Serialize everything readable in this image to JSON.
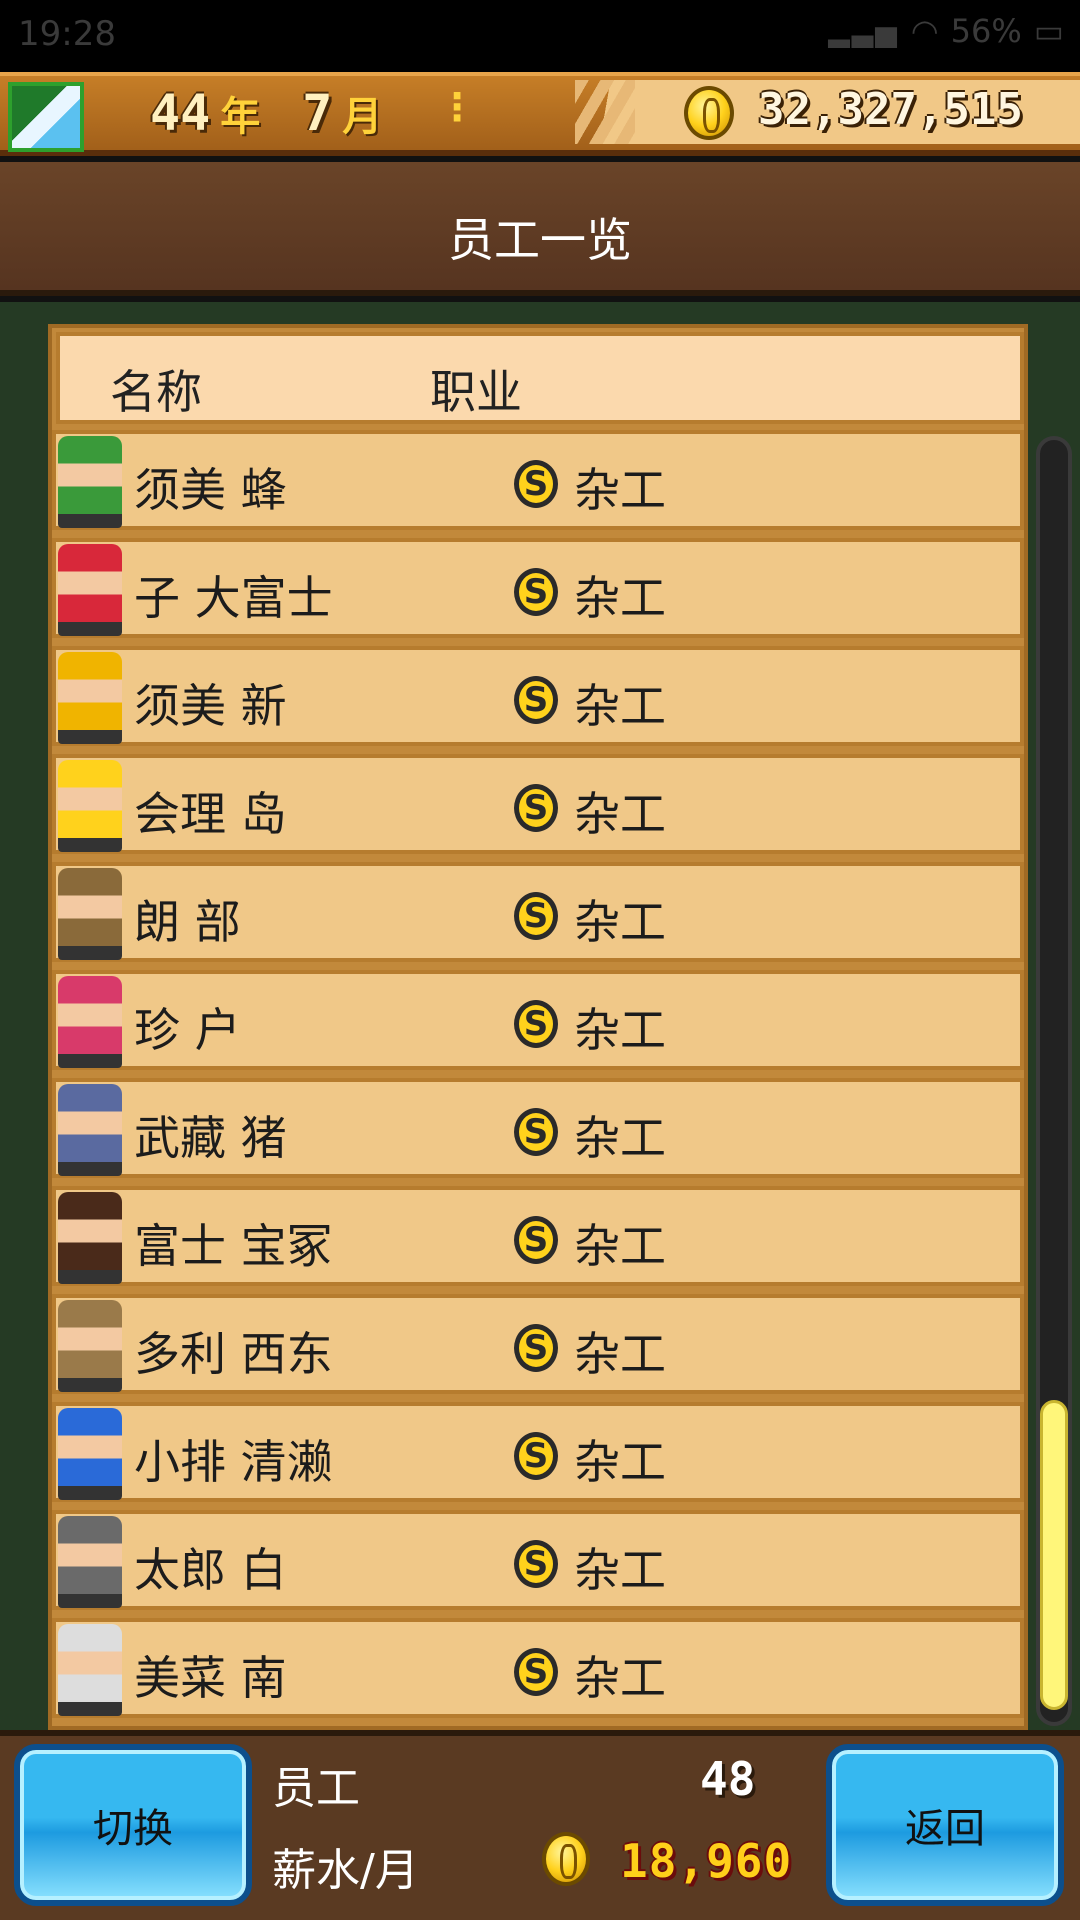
{
  "status_bar": {
    "time": "19:28",
    "indicators": "... HD",
    "battery": "56%"
  },
  "hud": {
    "year_value": "44",
    "year_unit": "年",
    "month_value": "7",
    "month_unit": "月",
    "money": "32,327,515",
    "menu_icon": "vertical-dots"
  },
  "screen": {
    "title": "员工一览"
  },
  "table": {
    "headers": {
      "name": "名称",
      "job": "职业"
    },
    "rows": [
      {
        "name": "须美 蜂",
        "job": "杂工",
        "rank": "S"
      },
      {
        "name": "子 大富士",
        "job": "杂工",
        "rank": "S"
      },
      {
        "name": "须美 新",
        "job": "杂工",
        "rank": "S"
      },
      {
        "name": "会理 岛",
        "job": "杂工",
        "rank": "S"
      },
      {
        "name": "朗 部",
        "job": "杂工",
        "rank": "S"
      },
      {
        "name": "珍 户",
        "job": "杂工",
        "rank": "S"
      },
      {
        "name": "武藏 猪",
        "job": "杂工",
        "rank": "S"
      },
      {
        "name": "富士 宝冢",
        "job": "杂工",
        "rank": "S"
      },
      {
        "name": "多利 西东",
        "job": "杂工",
        "rank": "S"
      },
      {
        "name": "小排 清濑",
        "job": "杂工",
        "rank": "S"
      },
      {
        "name": "太郎 白",
        "job": "杂工",
        "rank": "S"
      },
      {
        "name": "美菜 南",
        "job": "杂工",
        "rank": "S"
      }
    ]
  },
  "footer": {
    "switch_label": "切换",
    "back_label": "返回",
    "employees_label": "员工",
    "employees_count": "48",
    "salary_label": "薪水/月",
    "salary_value": "18,960"
  },
  "colors": {
    "row_bg": "#f0c888",
    "header_bg": "#fbd9ad",
    "button_blue": "#1d9be0",
    "salary_gold": "#ffcf1a"
  }
}
